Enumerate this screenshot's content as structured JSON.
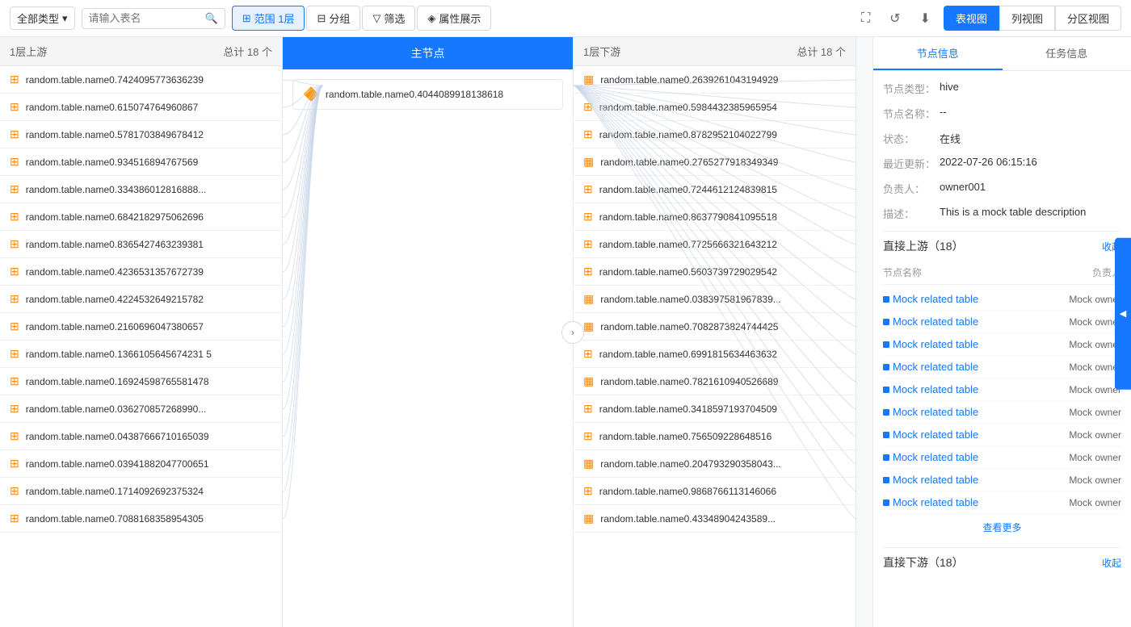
{
  "toolbar": {
    "type_label": "全部类型",
    "search_placeholder": "请输入表名",
    "btn_range": "范围 1层",
    "btn_group": "分组",
    "btn_filter": "筛选",
    "btn_attr": "属性展示",
    "btn_view_table": "表视图",
    "btn_view_list": "列视图",
    "btn_view_partition": "分区视图"
  },
  "left_col": {
    "title": "1层上游",
    "count": "总计 18 个",
    "items": [
      {
        "icon": "🔶",
        "name": "random.table.name0.7424095773636239",
        "type": "hive"
      },
      {
        "icon": "🔶",
        "name": "random.table.name0.615074764960867",
        "type": "hive"
      },
      {
        "icon": "🔶",
        "name": "random.table.name0.5781703849678412",
        "type": "hive"
      },
      {
        "icon": "🔶",
        "name": "random.table.name0.934516894767569",
        "type": "hive"
      },
      {
        "icon": "🔶",
        "name": "random.table.name0.334386012816888...",
        "type": "hive"
      },
      {
        "icon": "🔶",
        "name": "random.table.name0.6842182975062696",
        "type": "hive"
      },
      {
        "icon": "🔶",
        "name": "random.table.name0.8365427463239381",
        "type": "hive"
      },
      {
        "icon": "🔶",
        "name": "random.table.name0.4236531357672739",
        "type": "hive"
      },
      {
        "icon": "🔶",
        "name": "random.table.name0.4224532649215782",
        "type": "hive"
      },
      {
        "icon": "🔶",
        "name": "random.table.name0.2160696047380657",
        "type": "hive"
      },
      {
        "icon": "🔶",
        "name": "random.table.name0.1366105645674231 5",
        "type": "hive"
      },
      {
        "icon": "🔶",
        "name": "random.table.name0.16924598765581478",
        "type": "hive"
      },
      {
        "icon": "🔶",
        "name": "random.table.name0.036270857268990...",
        "type": "hive"
      },
      {
        "icon": "🔶",
        "name": "random.table.name0.04387666710165039",
        "type": "hive"
      },
      {
        "icon": "🔶",
        "name": "random.table.name0.03941882047700651",
        "type": "hive"
      },
      {
        "icon": "🔶",
        "name": "random.table.name0.1714092692375324",
        "type": "hive"
      },
      {
        "icon": "🔶",
        "name": "random.table.name0.7088168358954305",
        "type": "hive"
      }
    ]
  },
  "center_col": {
    "title": "主节点",
    "main_node": "random.table.name0.4044089918138618"
  },
  "right_col": {
    "title": "1层下游",
    "count": "总计 18 个",
    "items": [
      {
        "icon": "🔷",
        "name": "random.table.name0.2639261043194929",
        "type": "mysql"
      },
      {
        "icon": "🔶",
        "name": "random.table.name0.5984432385965954",
        "type": "hive"
      },
      {
        "icon": "🔶",
        "name": "random.table.name0.8782952104022799",
        "type": "hive"
      },
      {
        "icon": "🔷",
        "name": "random.table.name0.2765277918349349",
        "type": "mysql"
      },
      {
        "icon": "🔶",
        "name": "random.table.name0.7244612124839815",
        "type": "hive"
      },
      {
        "icon": "🔶",
        "name": "random.table.name0.8637790841095518",
        "type": "hive"
      },
      {
        "icon": "🔶",
        "name": "random.table.name0.7725666321643212",
        "type": "hive"
      },
      {
        "icon": "🔶",
        "name": "random.table.name0.5603739729029542",
        "type": "hive"
      },
      {
        "icon": "🔷",
        "name": "random.table.name0.038397581967839...",
        "type": "mysql"
      },
      {
        "icon": "🔷",
        "name": "random.table.name0.7082873824744425",
        "type": "mysql"
      },
      {
        "icon": "🔶",
        "name": "random.table.name0.6991815634463632",
        "type": "hive"
      },
      {
        "icon": "🔷",
        "name": "random.table.name0.7821610940526689",
        "type": "mysql"
      },
      {
        "icon": "🔶",
        "name": "random.table.name0.3418597193704509",
        "type": "hive"
      },
      {
        "icon": "🔶",
        "name": "random.table.name0.756509228648516",
        "type": "hive"
      },
      {
        "icon": "🔷",
        "name": "random.table.name0.204793290358043...",
        "type": "mysql"
      },
      {
        "icon": "🔶",
        "name": "random.table.name0.9868766113146066",
        "type": "hive"
      },
      {
        "icon": "🔷",
        "name": "random.table.name0.43348904243589...",
        "type": "mysql"
      }
    ]
  },
  "right_panel": {
    "tabs": [
      "节点信息",
      "任务信息"
    ],
    "active_tab": 0,
    "node_info": {
      "type_label": "节点类型：",
      "type_value": "hive",
      "name_label": "节点名称：",
      "name_value": "--",
      "status_label": "状态：",
      "status_value": "在线",
      "update_label": "最近更新：",
      "update_value": "2022-07-26 06:15:16",
      "owner_label": "负责人：",
      "owner_value": "owner001",
      "desc_label": "描述：",
      "desc_value": "This is a mock table description"
    },
    "upstream_section": {
      "title": "直接上游（18）",
      "collapse_label": "收起",
      "col_name": "节点名称",
      "col_owner": "负责人",
      "items": [
        {
          "name": "Mock related table",
          "owner": "Mock owner"
        },
        {
          "name": "Mock related table",
          "owner": "Mock owner"
        },
        {
          "name": "Mock related table",
          "owner": "Mock owner"
        },
        {
          "name": "Mock related table",
          "owner": "Mock owner"
        },
        {
          "name": "Mock related table",
          "owner": "Mock owner"
        },
        {
          "name": "Mock related table",
          "owner": "Mock owner"
        },
        {
          "name": "Mock related table",
          "owner": "Mock owner"
        },
        {
          "name": "Mock related table",
          "owner": "Mock owner"
        },
        {
          "name": "Mock related table",
          "owner": "Mock owner"
        },
        {
          "name": "Mock related table",
          "owner": "Mock owner"
        }
      ],
      "show_more": "查看更多"
    },
    "downstream_section": {
      "title": "直接下游（18）",
      "collapse_label": "收起"
    }
  }
}
